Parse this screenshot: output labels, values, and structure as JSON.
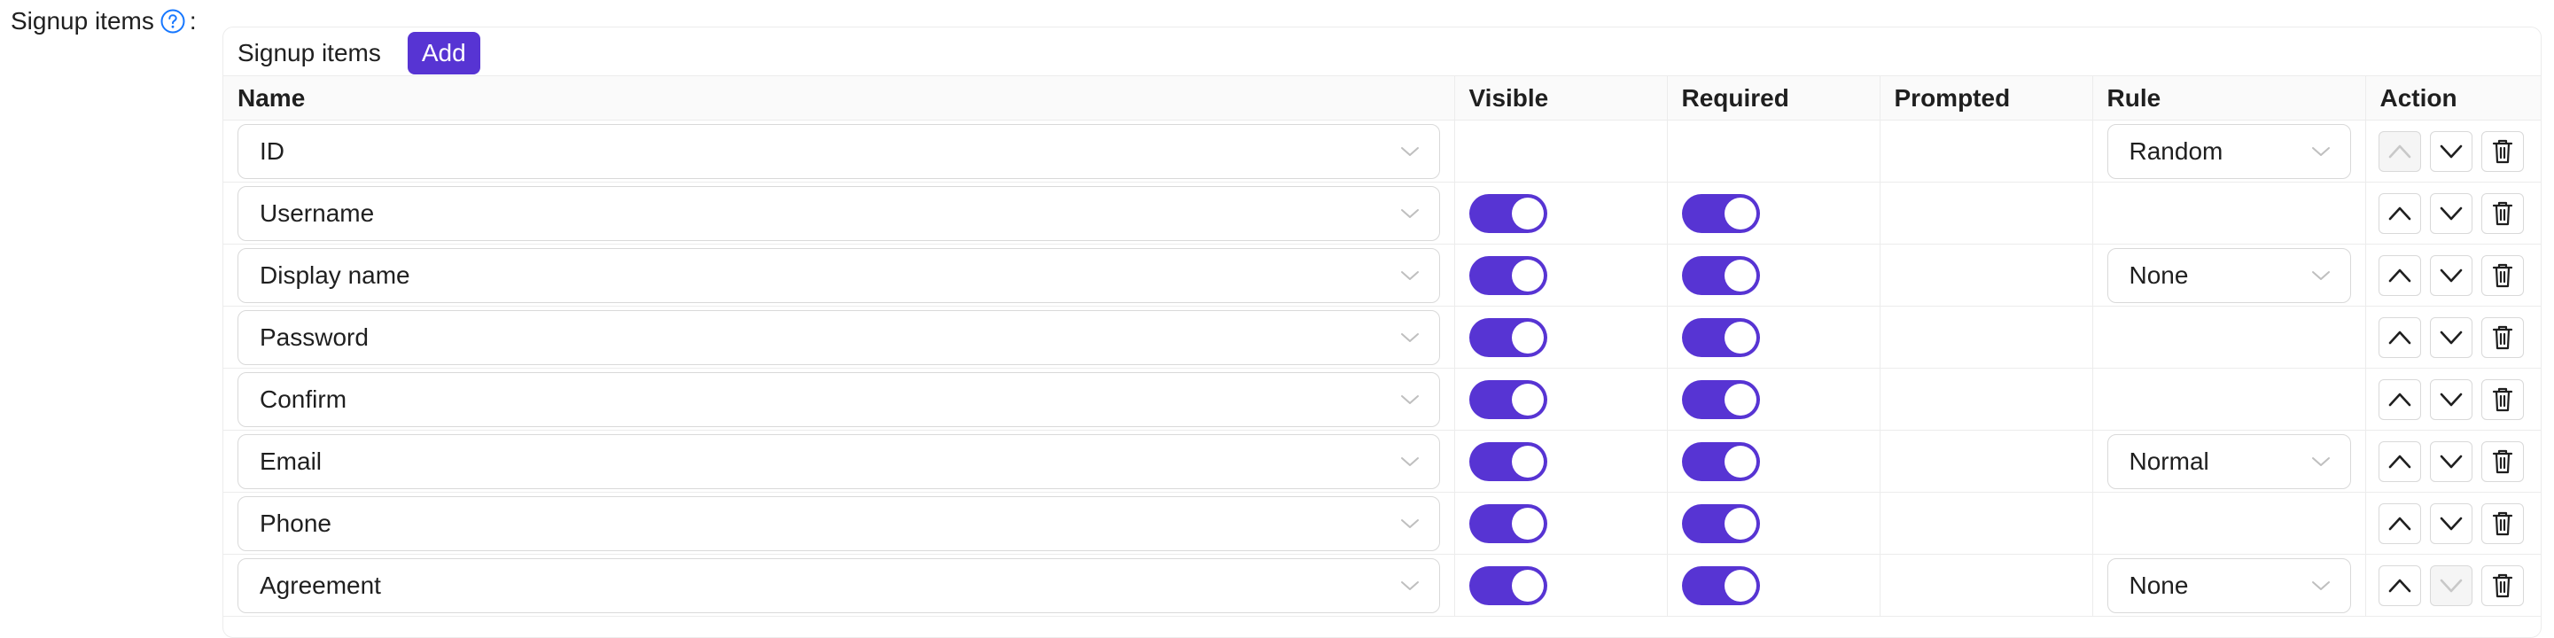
{
  "form": {
    "label": "Signup items",
    "colon": ":"
  },
  "card": {
    "title": "Signup items",
    "add_label": "Add"
  },
  "table": {
    "headers": {
      "name": "Name",
      "visible": "Visible",
      "required": "Required",
      "prompted": "Prompted",
      "rule": "Rule",
      "action": "Action"
    },
    "rows": [
      {
        "name": "ID",
        "visible": null,
        "required": null,
        "rule": "Random",
        "up_disabled": true,
        "down_disabled": false
      },
      {
        "name": "Username",
        "visible": true,
        "required": true,
        "rule": null,
        "up_disabled": false,
        "down_disabled": false
      },
      {
        "name": "Display name",
        "visible": true,
        "required": true,
        "rule": "None",
        "up_disabled": false,
        "down_disabled": false
      },
      {
        "name": "Password",
        "visible": true,
        "required": true,
        "rule": null,
        "up_disabled": false,
        "down_disabled": false
      },
      {
        "name": "Confirm",
        "visible": true,
        "required": true,
        "rule": null,
        "up_disabled": false,
        "down_disabled": false
      },
      {
        "name": "Email",
        "visible": true,
        "required": true,
        "rule": "Normal",
        "up_disabled": false,
        "down_disabled": false
      },
      {
        "name": "Phone",
        "visible": true,
        "required": true,
        "rule": null,
        "up_disabled": false,
        "down_disabled": false
      },
      {
        "name": "Agreement",
        "visible": true,
        "required": true,
        "rule": "None",
        "up_disabled": false,
        "down_disabled": true
      }
    ]
  },
  "colors": {
    "accent": "#5734d3",
    "border": "#d9d9d9",
    "header_bg": "#fafafa",
    "help_icon": "#1677ff"
  },
  "icons": {
    "help": "question-circle-icon",
    "select_arrow": "chevron-down-icon",
    "move_up": "chevron-up-icon",
    "move_down": "chevron-down-icon",
    "delete": "trash-icon"
  }
}
